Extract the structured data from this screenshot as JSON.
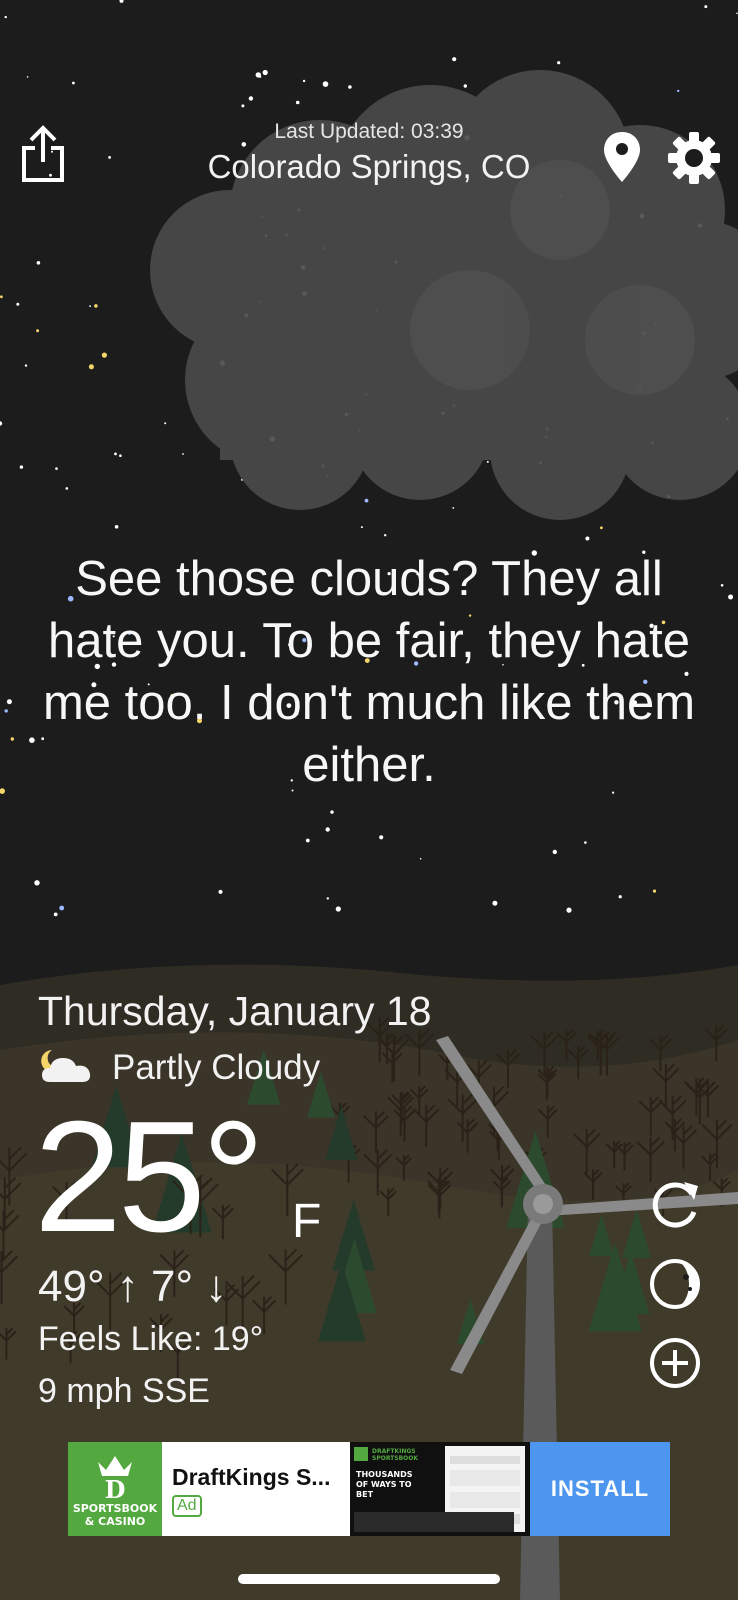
{
  "header": {
    "share_icon": "share-icon",
    "last_updated": "Last Updated: 03:39",
    "location": "Colorado Springs, CO",
    "location_icon": "map-pin-icon",
    "settings_icon": "gear-icon"
  },
  "quote": "See those clouds? They all hate you. To be fair, they hate me too. I don't much like them either.",
  "weather": {
    "date": "Thursday, January 18",
    "condition_icon": "partly-cloudy-night-icon",
    "condition": "Partly Cloudy",
    "temperature": "25°",
    "unit": "F",
    "high_low": "49° ↑ 7° ↓",
    "feels_like": "Feels Like: 19°",
    "wind": "9 mph SSE"
  },
  "side_buttons": {
    "refresh_icon": "refresh-icon",
    "moon_icon": "moon-phase-icon",
    "add_icon": "add-circle-icon"
  },
  "ad": {
    "logo_text_1": "SPORTSBOOK",
    "logo_text_2": "& CASINO",
    "title": "DraftKings S...",
    "tag": "Ad",
    "creative_text": "THOUSANDS OF WAYS TO BET",
    "creative_brand": "DRAFTKINGS SPORTSBOOK",
    "install": "INSTALL",
    "brand_color": "#53a93f",
    "install_color": "#4c96f0"
  },
  "colors": {
    "sky": "#1c1c1c",
    "cloud": "#4a4a4a",
    "ground": "#3f3a2c"
  }
}
